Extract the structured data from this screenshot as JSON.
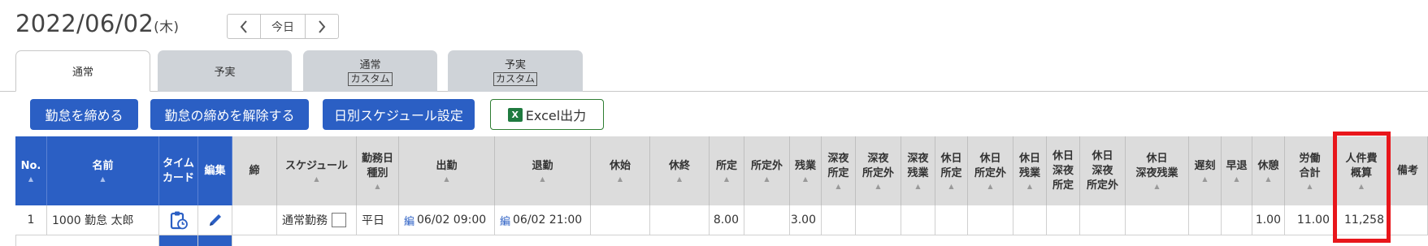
{
  "header": {
    "date": "2022/06/02",
    "day_of_week": "(木)",
    "prev_icon": "chevron-left",
    "today_label": "今日",
    "next_icon": "chevron-right"
  },
  "tabs": [
    {
      "label": "通常",
      "sub": "",
      "active": true
    },
    {
      "label": "予実",
      "sub": "",
      "active": false
    },
    {
      "label": "通常",
      "sub": "カスタム",
      "active": false
    },
    {
      "label": "予実",
      "sub": "カスタム",
      "active": false
    }
  ],
  "toolbar": {
    "close_label": "勤怠を締める",
    "unclose_label": "勤怠の締めを解除する",
    "schedule_label": "日別スケジュール設定",
    "excel_icon_text": "X",
    "excel_label": "Excel出力",
    "excel_icon": "excel-icon"
  },
  "table": {
    "columns": [
      {
        "lines": [
          "No."
        ],
        "sortable": true
      },
      {
        "lines": [
          "名前"
        ],
        "sortable": true
      },
      {
        "lines": [
          "タイム",
          "カード"
        ],
        "sortable": false
      },
      {
        "lines": [
          "編集"
        ],
        "sortable": false
      },
      {
        "lines": [
          "締"
        ],
        "sortable": false
      },
      {
        "lines": [
          "スケジュール"
        ],
        "sortable": true
      },
      {
        "lines": [
          "勤務日",
          "種別"
        ],
        "sortable": true
      },
      {
        "lines": [
          "出勤"
        ],
        "sortable": true
      },
      {
        "lines": [
          "退勤"
        ],
        "sortable": true
      },
      {
        "lines": [
          "休始"
        ],
        "sortable": true
      },
      {
        "lines": [
          "休終"
        ],
        "sortable": true
      },
      {
        "lines": [
          "所定"
        ],
        "sortable": true
      },
      {
        "lines": [
          "所定外"
        ],
        "sortable": true
      },
      {
        "lines": [
          "残業"
        ],
        "sortable": true
      },
      {
        "lines": [
          "深夜",
          "所定"
        ],
        "sortable": true
      },
      {
        "lines": [
          "深夜",
          "所定外"
        ],
        "sortable": true
      },
      {
        "lines": [
          "深夜",
          "残業"
        ],
        "sortable": true
      },
      {
        "lines": [
          "休日",
          "所定"
        ],
        "sortable": true
      },
      {
        "lines": [
          "休日",
          "所定外"
        ],
        "sortable": true
      },
      {
        "lines": [
          "休日",
          "残業"
        ],
        "sortable": true
      },
      {
        "lines": [
          "休日",
          "深夜",
          "所定"
        ],
        "sortable": true
      },
      {
        "lines": [
          "休日",
          "深夜",
          "所定外"
        ],
        "sortable": true
      },
      {
        "lines": [
          "休日",
          "深夜残業"
        ],
        "sortable": true
      },
      {
        "lines": [
          "遅刻"
        ],
        "sortable": true
      },
      {
        "lines": [
          "早退"
        ],
        "sortable": true
      },
      {
        "lines": [
          "休憩"
        ],
        "sortable": true
      },
      {
        "lines": [
          "労働",
          "合計"
        ],
        "sortable": true
      },
      {
        "lines": [
          "人件費",
          "概算"
        ],
        "sortable": true
      },
      {
        "lines": [
          "備考"
        ],
        "sortable": false
      }
    ],
    "rows": [
      {
        "no": "1",
        "name": "1000 勤怠 太郎",
        "timecard_icon": "clipboard-clock-icon",
        "edit_icon": "pencil-icon",
        "closed": "",
        "schedule": "通常勤務",
        "day_type": "平日",
        "clock_in_edit": "編",
        "clock_in": "06/02 09:00",
        "clock_out_edit": "編",
        "clock_out": "06/02 21:00",
        "break_start": "",
        "break_end": "",
        "scheduled": "8.00",
        "non_scheduled": "",
        "overtime": "3.00",
        "break_total": "1.00",
        "work_total": "11.00",
        "labor_cost": "11,258"
      }
    ]
  },
  "colors": {
    "primary": "#2b5fc4",
    "header_gray": "#dcdcdc",
    "tab_inactive": "#cfd3d8",
    "highlight": "#e8161b",
    "excel_green": "#1f7a3f"
  }
}
